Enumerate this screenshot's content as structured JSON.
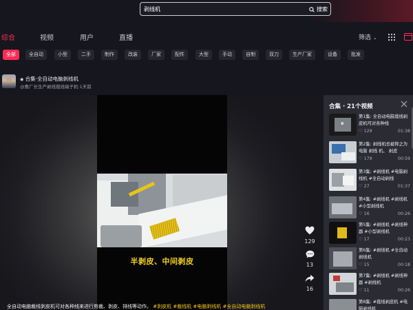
{
  "search": {
    "query": "剥线机",
    "button_label": "搜索"
  },
  "tabs": [
    "综合",
    "视频",
    "用户",
    "直播"
  ],
  "filter_label": "筛选",
  "chips": [
    "全部",
    "全自动",
    "小型",
    "二手",
    "制作",
    "改装",
    "厂家",
    "配件",
    "大型",
    "手动",
    "自制",
    "双刀",
    "生产厂家",
    "设备",
    "批发"
  ],
  "post": {
    "collection_label": "合集·全自动电脑剥线机",
    "author_line": "@惠厂长生产剥线裁线端子机·1天前",
    "caption": "半剥皮、中间剥皮",
    "likes": "129",
    "comments": "13",
    "shares": "16",
    "description": "全自动电脑裁线剥皮机可对各种线来进行剪裁、剥皮、排线等动作。",
    "hashtags": "#剥皮机 #裁线机 #电脑剥线机 #全自动电脑剥线机"
  },
  "sidebar": {
    "title": "合集 · 21个视频",
    "episodes": [
      {
        "title": "第1集: 全自动电脑裁线剥皮机可对各种线",
        "likes": "129",
        "duration": "01:38"
      },
      {
        "title": "第2集: 剥线机也被称之为 电脑 剥线 机、 剥皮",
        "likes": "179",
        "duration": "00:59"
      },
      {
        "title": "第3集: #剥线机 #电脑剥线机 #全自动剥线",
        "likes": "27",
        "duration": "01:37"
      },
      {
        "title": "第4集: #剥线机 #剥线机 #小型剥线机",
        "likes": "16",
        "duration": "00:26"
      },
      {
        "title": "第5集: #剥线机 #剥线神器 #小型剥线机",
        "likes": "17",
        "duration": "00:23"
      },
      {
        "title": "第6集: #剥线机 #全自动剥线机",
        "likes": "15",
        "duration": "00:18"
      },
      {
        "title": "第7集: #剥线机 #剥线神器 #剥线机",
        "likes": "11",
        "duration": "00:26"
      },
      {
        "title": "第8集: #裁线剥皮机 #电脑剥线机",
        "likes": "",
        "duration": ""
      }
    ]
  },
  "colors": {
    "accent": "#fe2c55",
    "tag": "#f5c518",
    "caption": "#f5d31a"
  }
}
